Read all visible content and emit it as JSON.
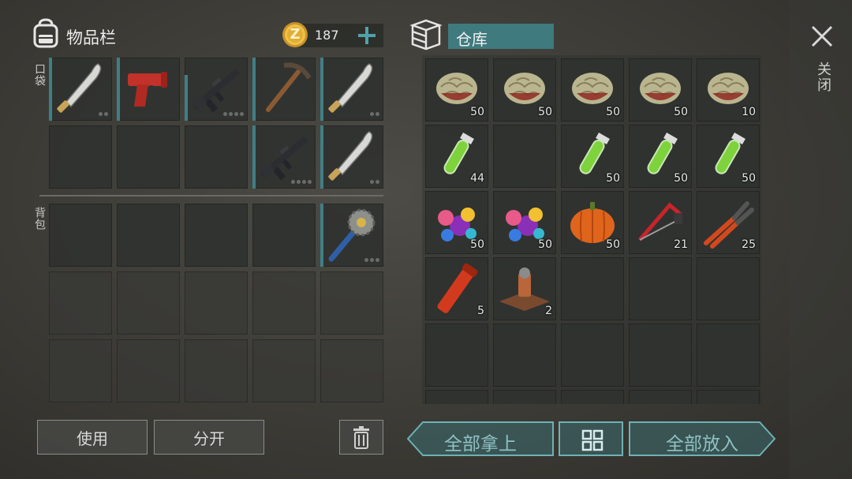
{
  "left_panel": {
    "title": "物品栏",
    "coin_count": "187",
    "coin_glyph": "Z",
    "add_symbol": "+",
    "pocket_label": "口袋",
    "backpack_label": "背包",
    "pocket_items": [
      {
        "icon": "machete-icon",
        "has_dots": true
      },
      {
        "icon": "flare-gun-icon",
        "has_dots": false
      },
      {
        "icon": "assault-rifle-icon",
        "has_dots": true
      },
      {
        "icon": "pickaxe-icon",
        "has_dots": false
      },
      {
        "icon": "machete-icon",
        "has_dots": true
      },
      {
        "icon": "assault-rifle-icon",
        "has_dots": true
      },
      {
        "icon": "machete-icon",
        "has_dots": true
      }
    ],
    "backpack_items": [
      {
        "icon": "saw-blade-mace-icon",
        "has_dots": true
      }
    ],
    "use_button": "使用",
    "split_button": "分开"
  },
  "right_panel": {
    "title": "仓库",
    "items": [
      {
        "icon": "brain-icon",
        "qty": "50"
      },
      {
        "icon": "brain-icon",
        "qty": "50"
      },
      {
        "icon": "brain-icon",
        "qty": "50"
      },
      {
        "icon": "brain-icon",
        "qty": "50"
      },
      {
        "icon": "brain-icon",
        "qty": "10"
      },
      {
        "icon": "green-test-tube-icon",
        "qty": "44"
      },
      {
        "icon": "green-test-tube-icon",
        "qty": "50"
      },
      {
        "icon": "green-test-tube-icon",
        "qty": "50"
      },
      {
        "icon": "green-test-tube-icon",
        "qty": "50"
      },
      {
        "icon": "candy-icon",
        "qty": "50"
      },
      {
        "icon": "candy-icon",
        "qty": "50"
      },
      {
        "icon": "pumpkin-icon",
        "qty": "50"
      },
      {
        "icon": "hacksaw-icon",
        "qty": "21"
      },
      {
        "icon": "pliers-icon",
        "qty": "25"
      },
      {
        "icon": "red-pipe-icon",
        "qty": "5"
      },
      {
        "icon": "bellows-icon",
        "qty": "2"
      }
    ],
    "take_all_button": "全部拿上",
    "put_all_button": "全部放入"
  },
  "close_label": "关闭",
  "colors": {
    "accent_teal": "#3f7f86",
    "button_teal": "#4f8f93",
    "coin_gold": "#d9a93a"
  }
}
